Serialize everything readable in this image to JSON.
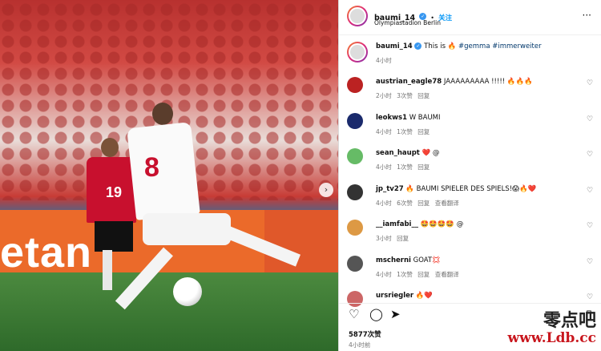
{
  "post": {
    "username": "baumi_14",
    "follow": "关注",
    "location": "Olympiastadion Berlin"
  },
  "caption": {
    "username": "baumi_14",
    "text": "This is ",
    "emoji": "🔥",
    "tags": "#gemma #immerweiter",
    "time": "4小时"
  },
  "comments": [
    {
      "user": "austrian_eagle78",
      "text": "JAAAAAAAAA !!!!! 🔥🔥🔥",
      "meta": "2小时 3次赞 回复"
    },
    {
      "user": "leokws1",
      "text": "W BAUMI",
      "meta": "4小时 1次赞 回复"
    },
    {
      "user": "sean_haupt",
      "text": "❤️ @",
      "meta": "4小时 1次赞 回复"
    },
    {
      "user": "jp_tv27",
      "text": "🔥 BAUMI SPIELER DES SPIELS!😱🔥❤️",
      "meta": "4小时 6次赞 回复 查看翻译"
    },
    {
      "user": "__iamfabi__",
      "text": "🤩🤩🤩🤩 @",
      "meta": "3小时 回复"
    },
    {
      "user": "mscherni",
      "text": "GOAT💢",
      "meta": "4小时 1次赞 回复 查看翻译"
    },
    {
      "user": "ursriegler",
      "text": "🔥❤️",
      "meta": ""
    }
  ],
  "stats": {
    "likes": "5877次赞",
    "time": "4小时前"
  },
  "photo": {
    "board_text": "etan",
    "shirt_a": "19",
    "shirt_b": "8"
  },
  "watermark": {
    "cn": "零点吧",
    "url": "www.Ldb.cc"
  },
  "icons": [
    "heart-icon",
    "comment-icon",
    "share-icon",
    "bookmark-icon",
    "more-icon",
    "next-arrow-icon"
  ]
}
